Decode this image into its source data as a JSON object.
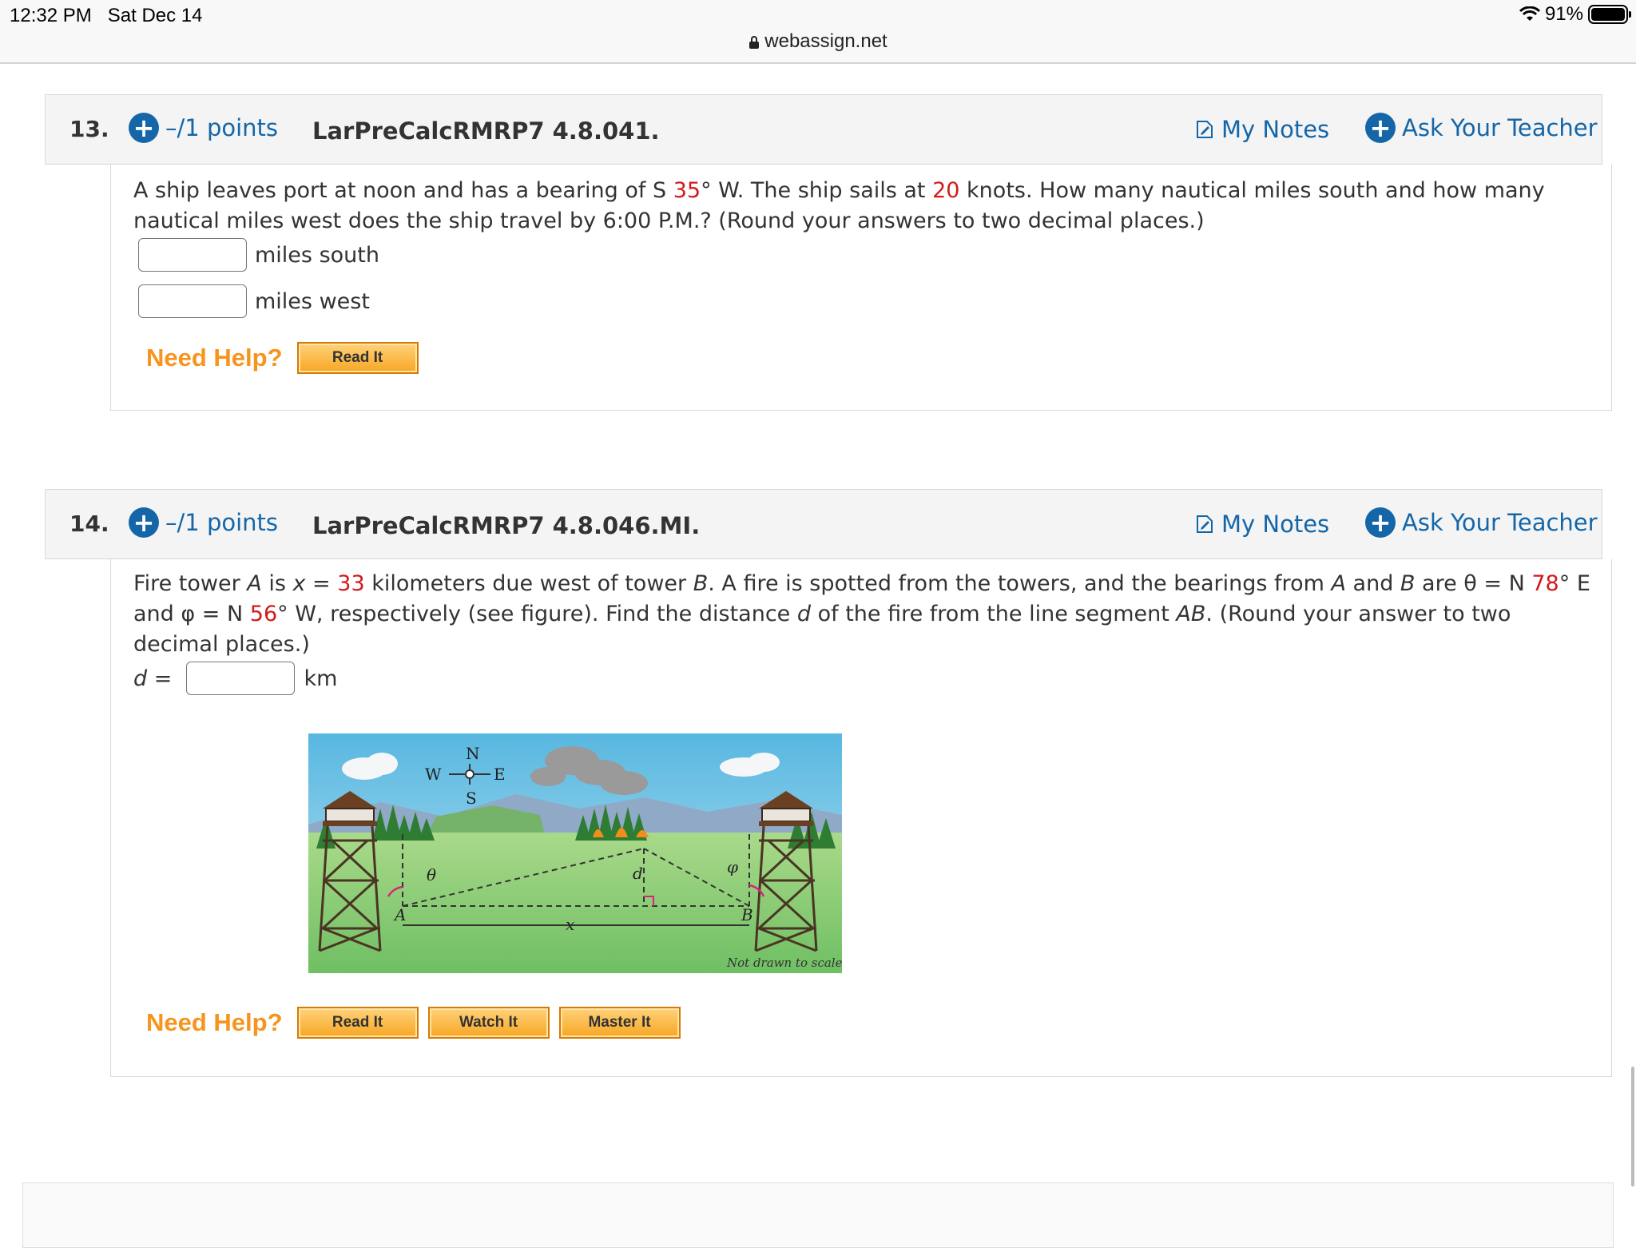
{
  "status": {
    "time": "12:32 PM",
    "date": "Sat Dec 14",
    "battery": "91%",
    "url": "webassign.net"
  },
  "q13": {
    "number": "13.",
    "points": "–/1 points",
    "id": "LarPreCalcRMRP7 4.8.041.",
    "my_notes": "My Notes",
    "ask_teacher": "Ask Your Teacher",
    "text_a": "A ship leaves port at noon and has a bearing of S ",
    "bearing": "35",
    "text_b": "° W. The ship sails at ",
    "speed": "20",
    "text_c": " knots. How many nautical miles south and how many nautical miles west does the ship travel by 6:00 P.M.? (Round your answers to two decimal places.)",
    "answer1_label": "miles south",
    "answer2_label": "miles west",
    "need_help": "Need Help?",
    "read_it": "Read It"
  },
  "q14": {
    "number": "14.",
    "points": "–/1 points",
    "id": "LarPreCalcRMRP7 4.8.046.MI.",
    "my_notes": "My Notes",
    "ask_teacher": "Ask Your Teacher",
    "t1": "Fire tower ",
    "A": "A",
    "t2": " is ",
    "x": "x",
    "t3": " = ",
    "x_val": "33",
    "t4": " kilometers due west of tower ",
    "B": "B",
    "t5": ". A fire is spotted from the towers, and the bearings from ",
    "t6": " and ",
    "t7": " are θ = N ",
    "theta_val": "78",
    "t8": "° E and φ = N ",
    "phi_val": "56",
    "t9": "° W, respectively (see figure). Find the distance ",
    "d": "d",
    "t10": " of the fire from the line segment ",
    "AB": "AB",
    "t11": ". (Round your answer to two decimal places.)",
    "d_label": "d",
    "d_eq": "=",
    "unit": "km",
    "need_help": "Need Help?",
    "read_it": "Read It",
    "watch_it": "Watch It",
    "master_it": "Master It",
    "figure": {
      "compass_n": "N",
      "compass_s": "S",
      "compass_e": "E",
      "compass_w": "W",
      "label_theta": "θ",
      "label_phi": "φ",
      "label_d": "d",
      "label_A": "A",
      "label_B": "B",
      "label_x": "x",
      "note": "Not drawn to scale"
    }
  }
}
